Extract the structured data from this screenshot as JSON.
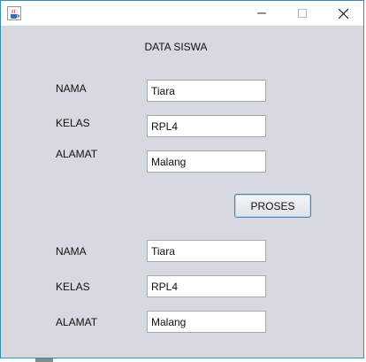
{
  "window": {
    "icon": "java-cup-icon",
    "controls": [
      "minimize",
      "maximize",
      "close"
    ]
  },
  "heading": "DATA SISWA",
  "input_section": {
    "nama_label": "NAMA",
    "nama_value": "Tiara",
    "kelas_label": "KELAS",
    "kelas_value": "RPL4",
    "alamat_label": "ALAMAT",
    "alamat_value": "Malang"
  },
  "proses_button": "PROSES",
  "output_section": {
    "nama_label": "NAMA",
    "nama_value": "Tiara",
    "kelas_label": "KELAS",
    "kelas_value": "RPL4",
    "alamat_label": "ALAMAT",
    "alamat_value": "Malang"
  },
  "colors": {
    "window_bg": "#d6d9df",
    "border": "#2f8fb6",
    "button_border": "#4a7fb0"
  }
}
